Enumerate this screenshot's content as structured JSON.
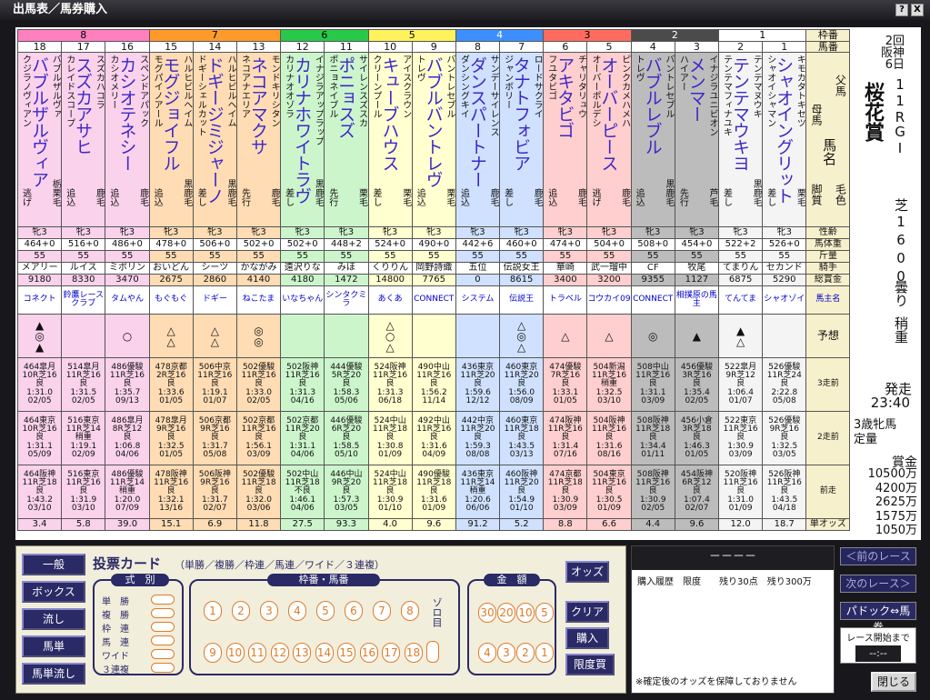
{
  "window": {
    "title": "出馬表／馬券購入",
    "help": "?",
    "close": "X"
  },
  "frame_colors": [
    "#ffffff",
    "#4b4b4b",
    "#ff6b5e",
    "#3d8fff",
    "#fff25c",
    "#28c84a",
    "#ff9a2a",
    "#ff7fbf"
  ],
  "frame_text_colors": [
    "#000000",
    "#ffffff",
    "#000000",
    "#ffffff",
    "#000000",
    "#000000",
    "#000000",
    "#000000"
  ],
  "frame_cell_colors": [
    "#f4f4f4",
    "#bcbcbc",
    "#ffcece",
    "#cfe1ff",
    "#ffffcf",
    "#ccf5cc",
    "#ffdcb4",
    "#fad2ec"
  ],
  "labels": {
    "waku": "枠番",
    "umaban": "馬番",
    "chichi": "父馬",
    "haha": "母馬",
    "umamei": "馬名",
    "keshoku": "毛色",
    "kyakushitsu": "脚質",
    "seirei": "性齢",
    "bataiju": "馬体重",
    "kinryo": "斤量",
    "kishu": "騎手",
    "soshokin": "総賞金",
    "banushi": "馬主名",
    "yoso": "予想",
    "sanso": "3走前",
    "niso": "2走前",
    "zenso": "前走",
    "odds": "単オッズ"
  },
  "race": {
    "kai": "2回",
    "place": "阪神",
    "day": "6日",
    "num": "11R",
    "grade": "GI",
    "name": "桜花賞",
    "course": "芝1600",
    "weather": "曇り",
    "track": "稍重",
    "start_label": "発走",
    "start_time": "23:40",
    "cond": "3歳牝馬",
    "cond2": "定量",
    "prize_label": "賞金",
    "prizes": [
      "10500万",
      "4200万",
      "2625万",
      "1575万",
      "1050万"
    ]
  },
  "horses": [
    {
      "frame": "8",
      "num": "18",
      "sire": "バブルザルヴァ",
      "dam": "クジラノヴィアン",
      "name": "バブルザルヴィア",
      "coat": "栃栗毛",
      "style": "逃げ",
      "sexage": "牝3",
      "weight": "464+0",
      "kinryo": "55",
      "jockey": "メアリー",
      "prize": "9180",
      "owner": "コネクト",
      "marks": "▲\n◎\n▲",
      "h3": "464皐月\n10R芝16\n良\n1:31.0\n02/05",
      "h2": "464東京\n10R芝16\n良\n1:31.1\n05/09",
      "h1": "464阪神\n11R芝18\n良\n1:43.2\n03/10",
      "odds": "3.4"
    },
    {
      "frame": "8",
      "num": "17",
      "sire": "スズカハコラ",
      "dam": "カレイドスコープ",
      "name": "スズカアサヒ",
      "coat": "鹿毛",
      "style": "追込",
      "sexage": "牝3",
      "weight": "516+0",
      "kinryo": "55",
      "jockey": "ルイス",
      "prize": "8330",
      "owner": "鈴鷹レースクラブ",
      "marks": "",
      "h3": "514皐月\n11R芝16\n良\n1:31.5\n02/05",
      "h2": "516東京\n11R芝14\n稍重\n1:19.1\n02/09",
      "h1": "516東京\n11R芝16\n良\n1:31.9\n03/10",
      "odds": "5.8"
    },
    {
      "frame": "8",
      "num": "16",
      "sire": "スペンドアパック",
      "dam": "カシオメリー",
      "name": "カシオテネシー",
      "coat": "鹿毛",
      "style": "追込",
      "sexage": "牝3",
      "weight": "486+0",
      "kinryo": "55",
      "jockey": "ミポリン",
      "prize": "3470",
      "owner": "タムやん",
      "marks": "○",
      "h3": "486優駿\n11R芝16\n良\n1:35.7\n09/13",
      "h2": "486皐月\n8R芝12\n良\n1:06.8\n04/06",
      "h1": "486優駿\n11R芝14\n稍重\n1:20.0\n07/09",
      "odds": "39.0"
    },
    {
      "frame": "7",
      "num": "15",
      "sire": "ハルヒビルヘイム",
      "dam": "モグパイノアール",
      "name": "モグジョイフル",
      "coat": "黒鹿毛",
      "style": "追込",
      "sexage": "牝3",
      "weight": "478+0",
      "kinryo": "55",
      "jockey": "おいどん",
      "prize": "2675",
      "owner": "もぐもぐ",
      "marks": "△\n△",
      "h3": "478京都\n2R芝16\n良\n1:33.6\n01/05",
      "h2": "478皐月\n9R芝16\n良\n1:32.5\n01/05",
      "h1": "478阪神\n11R芝16\n良\n1:32.1\n13/16",
      "odds": "15.1"
    },
    {
      "frame": "7",
      "num": "14",
      "sire": "ハルヒビルヘイム",
      "dam": "ドギーシェルカット",
      "name": "ドギージミジャーノ",
      "coat": "黒鹿毛",
      "style": "差し",
      "sexage": "牝3",
      "weight": "506+0",
      "kinryo": "55",
      "jockey": "シーツ",
      "prize": "2860",
      "owner": "ドギー",
      "marks": "△\n△",
      "h3": "506中京\n11R芝16\n良\n1:19.1\n01/07",
      "h2": "506京都\n9R芝16\n良\n1:31.7\n05/08",
      "h1": "506阪神\n9R芝16\n良\n1:31.7\n02/07",
      "odds": "6.9"
    },
    {
      "frame": "7",
      "num": "13",
      "sire": "モンドキリシタン",
      "dam": "ネコアナエリア",
      "name": "ネコアマクサ",
      "coat": "鹿毛",
      "style": "先行",
      "sexage": "牝3",
      "weight": "502+0",
      "kinryo": "55",
      "jockey": "かながみ",
      "prize": "4140",
      "owner": "ねこたま",
      "marks": "◎\n◎",
      "h3": "502優駿\n11R芝16\n良\n1:33.0\n02/05",
      "h2": "502京都\n11R芝16\n良\n1:56.1\n03/09",
      "h1": "502優駿\n11R芝18\n良\n1:32.0\n03/06",
      "odds": "11.8"
    },
    {
      "frame": "6",
      "num": "12",
      "sire": "イナジラアップラップ",
      "dam": "カリナオオゾラ",
      "name": "カリナホワイトラヴ",
      "coat": "黒鹿毛",
      "style": "差し",
      "sexage": "牝3",
      "weight": "502+0",
      "kinryo": "55",
      "jockey": "遠沢りな",
      "prize": "4180",
      "owner": "いなちゃん",
      "marks": "",
      "h3": "502阪神\n11R芝16\n良\n1:31.3\n04/16",
      "h2": "502京都\n11R芝20\n良\n1:31.1\n04/06",
      "h1": "502中山\n11R芝18\n不良\n1:46.1\n04/06",
      "odds": "27.5"
    },
    {
      "frame": "6",
      "num": "11",
      "sire": "サイレンスズスカ",
      "dam": "ポニョネイブル",
      "name": "ポニョスズ",
      "coat": "栗毛",
      "style": "先行",
      "sexage": "牝3",
      "weight": "448+2",
      "kinryo": "55",
      "jockey": "みほ",
      "prize": "1472",
      "owner": "シンタクミラ",
      "marks": "",
      "h3": "444優駿\n5R芝20\n良\n1:58.3\n05/06",
      "h2": "446優駿\n6R芝20\n良\n1:58.5\n05/10",
      "h1": "446中山\n9R芝20\n良\n1:57.3\n03/05",
      "odds": "93.3"
    },
    {
      "frame": "5",
      "num": "10",
      "sire": "アイスクラウン",
      "dam": "クリーンプール",
      "name": "キューブハウス",
      "coat": "栗毛",
      "style": "差し",
      "sexage": "牝3",
      "weight": "524+0",
      "kinryo": "55",
      "jockey": "くりりん",
      "prize": "14800",
      "owner": "あくあ",
      "marks": "△\n○\n△",
      "h3": "524阪神\n11R芝16\n良\n1:31.3\n06/18",
      "h2": "524中山\n11R芝18\n良\n1:30.8\n01/09",
      "h1": "524中山\n11R芝18\n良\n1:30.9\n01/10",
      "odds": "4.0"
    },
    {
      "frame": "5",
      "num": "9",
      "sire": "バントレセブル",
      "dam": "トレヴ",
      "name": "バブルバントレヴ",
      "coat": "栗毛",
      "style": "追込",
      "sexage": "牝3",
      "weight": "490+0",
      "kinryo": "55",
      "jockey": "岡野詩織",
      "prize": "7765",
      "owner": "CONNECT",
      "marks": "",
      "h3": "490中山\n11R芝16\n良\n1:56.2\n11/14",
      "h2": "492中山\n11R芝16\n良\n1:31.6\n04/09",
      "h1": "490優駿\n11R芝18\n良\n1:31.6\n01/09",
      "odds": "9.6"
    },
    {
      "frame": "4",
      "num": "8",
      "sire": "サンデーサイレンス",
      "dam": "ダンシングキイ",
      "name": "ダンスパートナー",
      "coat": "鹿毛",
      "style": "追込",
      "sexage": "牝3",
      "weight": "442+6",
      "kinryo": "55",
      "jockey": "五位",
      "prize": "0",
      "owner": "システム",
      "marks": "",
      "h3": "436東京\n11R芝20\n良\n1:59.6\n12/12",
      "h2": "442中京\n11R芝20\n良\n1:59.3\n08/08",
      "h1": "436東京\n11R芝14\n稍重\n1:20.6\n06/06",
      "odds": "91.2"
    },
    {
      "frame": "4",
      "num": "7",
      "sire": "ロードサクライ",
      "dam": "ジャンボリー",
      "name": "タナトフォビア",
      "coat": "鹿毛",
      "style": "差し",
      "sexage": "牝3",
      "weight": "460+0",
      "kinryo": "55",
      "jockey": "伝説女王",
      "prize": "8615",
      "owner": "伝説王",
      "marks": "△\n◎\n△",
      "h3": "460東京\n11R芝20\n良\n1:56.0\n08/09",
      "h2": "460東京\n11R芝18\n良\n1:43.5\n03/13",
      "h1": "460阪神\n11R芝20\n良\n1:54.9\n01/10",
      "odds": "5.2"
    },
    {
      "frame": "3",
      "num": "6",
      "sire": "チャリタリュウ",
      "dam": "フユタビゴ",
      "name": "アキタビゴ",
      "coat": "鹿毛",
      "style": "追込",
      "sexage": "牝3",
      "weight": "474+0",
      "kinryo": "55",
      "jockey": "華崎",
      "prize": "3400",
      "owner": "トラベル",
      "marks": "△",
      "h3": "474優駿\n7R芝16\n良\n1:33.1\n01/05",
      "h2": "474阪神\n11R芝16\n良\n1:31.4\n07/16",
      "h1": "474京都\n11R芝18\n良\n1:30.9\n03/09",
      "odds": "8.8"
    },
    {
      "frame": "3",
      "num": "5",
      "sire": "ピンクカメハメハ",
      "dam": "オーバーポルデシ",
      "name": "オーバーピース",
      "coat": "鹿毛",
      "style": "逃げ",
      "sexage": "牝3",
      "weight": "504+0",
      "kinryo": "55",
      "jockey": "武一瑠中",
      "prize": "3200",
      "owner": "コウカイ09",
      "marks": "△",
      "h3": "504新潟\n11R芝16\n稍重\n1:32.5\n03/10",
      "h2": "504阪神\n11R芝16\n良\n1:31.6\n08/16",
      "h1": "504東京\n11R芝16\n良\n1:30.5\n01/09",
      "odds": "6.6"
    },
    {
      "frame": "2",
      "num": "4",
      "sire": "バントレセブル",
      "dam": "トレヴ",
      "name": "バブルレブル",
      "coat": "黒鹿毛",
      "style": "追込",
      "sexage": "牝3",
      "weight": "508+0",
      "kinryo": "55",
      "jockey": "CF",
      "prize": "9355",
      "owner": "CONNECT",
      "marks": "◎",
      "h3": "508中山\n11R芝16\n良\n1:31.1\n03/09",
      "h2": "508阪神\n11R芝18\n良\n1:34.4\n01/11",
      "h1": "508阪神\n11R芝16\n良\n1:30.9\n02/05",
      "odds": "4.4"
    },
    {
      "frame": "2",
      "num": "3",
      "sire": "イナジラユニビオン",
      "dam": "ハイアー",
      "name": "メンマー",
      "coat": "芦毛",
      "style": "先行",
      "sexage": "牝3",
      "weight": "454+0",
      "kinryo": "55",
      "jockey": "牧尾",
      "prize": "1127",
      "owner": "相撲原の馬主",
      "marks": "▲",
      "h3": "456優駿\n3R芝16\n良\n1:35.4\n02/05",
      "h2": "456小倉\n3R芝18\n良\n1:46.3\n01/05",
      "h1": "454阪神\n6R芝12\n良\n1:07.4\n02/07",
      "odds": "9.6"
    },
    {
      "frame": "1",
      "num": "2",
      "sire": "テンテマヌウキ",
      "dam": "テンテマフィナユキ",
      "name": "テンテマウキヨ",
      "coat": "黒鹿毛",
      "style": "差し",
      "sexage": "牝3",
      "weight": "522+2",
      "kinryo": "55",
      "jockey": "てまりん",
      "prize": "6875",
      "owner": "てんてま",
      "marks": "▲\n△",
      "h3": "522皐月\n9R芝12\n良\n1:06.4\n01/07",
      "h2": "522東京\n11R芝16\n良\n1:30.9\n03/09",
      "h1": "520阪神\n11R芝16\n良\n1:31.0\n01/09",
      "odds": "12.0"
    },
    {
      "frame": "1",
      "num": "1",
      "sire": "キモカタトキセツ",
      "dam": "シャオイシャマン",
      "name": "シャオイングリット",
      "coat": "栗毛",
      "style": "差し",
      "sexage": "牝3",
      "weight": "526+0",
      "kinryo": "55",
      "jockey": "セカンド",
      "prize": "5290",
      "owner": "シャオゾイ",
      "marks": "",
      "h3": "526優駿\n11R芝24\n良\n2:22.8\n05/08",
      "h2": "526優駿\n9R芝16\n良\n1:32.5\n03/05",
      "h1": "526阪神\n11R芝16\n良\n1:43.5\n04/18",
      "odds": "18.7"
    }
  ],
  "bottom": {
    "left_buttons": [
      "一般",
      "ボックス",
      "流し",
      "馬単",
      "馬単流し"
    ],
    "card_title": "投票カード",
    "card_sub": "（単勝／複勝／枠連／馬連／ワイド／３連複）",
    "shiki_header": "式　別",
    "shiki": [
      "単　勝",
      "複　勝",
      "枠　連",
      "馬　連",
      "ワイド",
      "３連複"
    ],
    "waku_header": "枠番・馬番",
    "nums_top": [
      "1",
      "2",
      "3",
      "4",
      "5",
      "6",
      "7",
      "8"
    ],
    "nums_bot": [
      "9",
      "10",
      "11",
      "12",
      "13",
      "14",
      "15",
      "16",
      "17",
      "18"
    ],
    "zoro": "ゾロ目",
    "kin_header": "金　額",
    "kin_top": [
      "30",
      "20",
      "10",
      "5"
    ],
    "kin_bot": [
      "4",
      "3",
      "2",
      "1"
    ],
    "btn_odds": "オッズ",
    "btn_clear": "クリア",
    "btn_buy": "購入",
    "btn_limit": "限度買"
  },
  "history": {
    "display": "－－－－",
    "header": "購入履歴　限度　　残り30点　残り300万",
    "note": "※確定後のオッズを保障しておりません"
  },
  "nav": {
    "prev": "＜前のレース",
    "next": "次のレース＞",
    "paddock": "パドック⇔馬券",
    "race_start": "レース開始まで",
    "timer": "--:--",
    "close": "閉じる"
  }
}
